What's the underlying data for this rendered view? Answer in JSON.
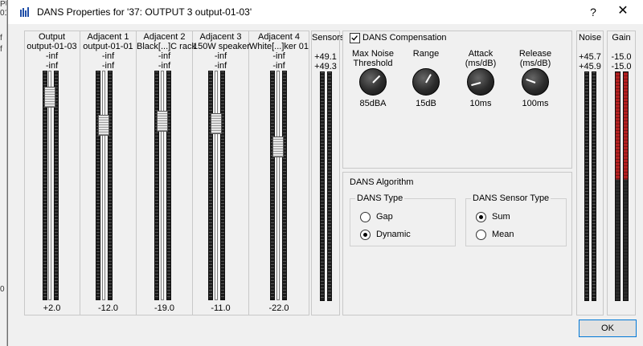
{
  "background_window": {
    "fragments": [
      "PU",
      "01-0",
      "f",
      "f",
      "0"
    ]
  },
  "window": {
    "title": "DANS Properties for '37: OUTPUT 3 output-01-03'",
    "help_glyph": "?",
    "close_glyph": "✕"
  },
  "strips": [
    {
      "name": "Output",
      "sub": "output-01-03",
      "l1": "-inf",
      "l2": "-inf",
      "value": "+2.0"
    },
    {
      "name": "Adjacent 1",
      "sub": "output-01-01",
      "l1": "-inf",
      "l2": "-inf",
      "value": "-12.0"
    },
    {
      "name": "Adjacent 2",
      "sub": "Black[...]C rack",
      "l1": "-inf",
      "l2": "-inf",
      "value": "-19.0"
    },
    {
      "name": "Adjacent 3",
      "sub": "150W speaker",
      "l1": "-inf",
      "l2": "-inf",
      "value": "-11.0"
    },
    {
      "name": "Adjacent 4",
      "sub": "White[...]ker 01",
      "l1": "-inf",
      "l2": "-inf",
      "value": "-22.0"
    }
  ],
  "sensors": {
    "title": "Sensors",
    "l1": "+49.1",
    "l2": "+49.3"
  },
  "compensation": {
    "label": "DANS Compensation",
    "checked": true,
    "knobs": [
      {
        "label_line1": "Max Noise",
        "label_line2": "Threshold",
        "value": "85dBA"
      },
      {
        "label_line1": "Range",
        "label_line2": "",
        "value": "15dB"
      },
      {
        "label_line1": "Attack",
        "label_line2": "(ms/dB)",
        "value": "10ms"
      },
      {
        "label_line1": "Release",
        "label_line2": "(ms/dB)",
        "value": "100ms"
      }
    ]
  },
  "algorithm": {
    "title": "DANS Algorithm",
    "type": {
      "title": "DANS Type",
      "options": [
        "Gap",
        "Dynamic"
      ],
      "selected": "Dynamic"
    },
    "sensor_type": {
      "title": "DANS Sensor Type",
      "options": [
        "Sum",
        "Mean"
      ],
      "selected": "Sum"
    }
  },
  "noise": {
    "title": "Noise",
    "l1": "+45.7",
    "l2": "+45.9"
  },
  "gain": {
    "title": "Gain",
    "l1": "-15.0",
    "l2": "-15.0"
  },
  "buttons": {
    "ok": "OK"
  }
}
